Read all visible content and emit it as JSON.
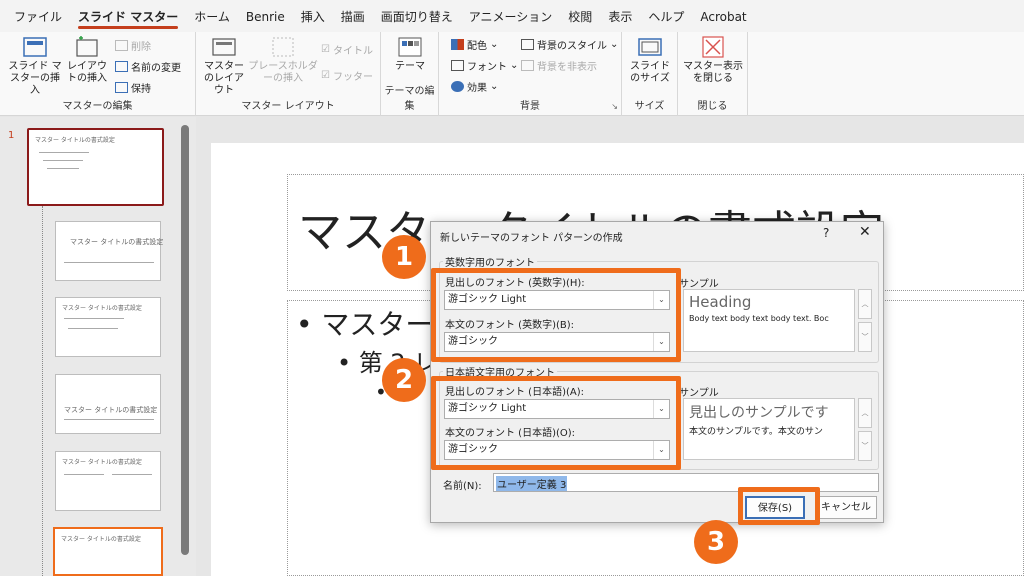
{
  "menubar": {
    "items": [
      "ファイル",
      "スライド マスター",
      "ホーム",
      "Benrie",
      "挿入",
      "描画",
      "画面切り替え",
      "アニメーション",
      "校閲",
      "表示",
      "ヘルプ",
      "Acrobat"
    ]
  },
  "ribbon": {
    "master_edit": {
      "insert_master": "スライド マスターの挿入",
      "insert_layout": "レイアウトの挿入",
      "delete": "削除",
      "rename": "名前の変更",
      "preserve": "保持",
      "label": "マスターの編集"
    },
    "master_layout": {
      "master_layout_btn": "マスターのレイアウト",
      "insert_placeholder": "プレースホルダーの挿入",
      "title_check": "タイトル",
      "footer_check": "フッター",
      "label": "マスター レイアウト"
    },
    "edit_theme": {
      "themes": "テーマ",
      "label": "テーマの編集"
    },
    "background": {
      "colors": "配色",
      "fonts": "フォント",
      "effects": "効果",
      "bg_styles": "背景のスタイル",
      "hide_bg": "背景を非表示",
      "label": "背景"
    },
    "size": {
      "slide_size": "スライドのサイズ",
      "label": "サイズ"
    },
    "close": {
      "close_master": "マスター表示を閉じる",
      "label": "閉じる"
    }
  },
  "thumbs": {
    "number": "1",
    "master_title": "マスター タイトルの書式設定",
    "layout_title": "マスター タイトルの書式設定"
  },
  "slide": {
    "title": "マスター タイトルの書式設定",
    "bullet1": "• マスター",
    "bullet2": "• 第 2 レ",
    "bullet3": "•"
  },
  "dialog": {
    "title": "新しいテーマのフォント パターンの作成",
    "help": "?",
    "close": "✕",
    "latin": {
      "legend": "英数字用のフォント",
      "heading_label": "見出しのフォント (英数字)(H):",
      "heading_value": "游ゴシック Light",
      "body_label": "本文のフォント (英数字)(B):",
      "body_value": "游ゴシック",
      "sample_label": "サンプル",
      "sample_heading": "Heading",
      "sample_body": "Body text body text body text. Boc"
    },
    "asian": {
      "legend": "日本語文字用のフォント",
      "heading_label": "見出しのフォント (日本語)(A):",
      "heading_value": "游ゴシック Light",
      "body_label": "本文のフォント (日本語)(O):",
      "body_value": "游ゴシック",
      "sample_label": "サンプル",
      "sample_heading": "見出しのサンプルです",
      "sample_body": "本文のサンプルです。本文のサン"
    },
    "name_label": "名前(N):",
    "name_value": "ユーザー定義 3",
    "save": "保存(S)",
    "cancel": "キャンセル"
  },
  "annotations": {
    "step1": "1",
    "step2": "2",
    "step3": "3",
    "color": "#ef6c1b"
  },
  "colors": {
    "accent": "#c43e1c",
    "highlight": "#ef6c1b",
    "selected_thumb": "#8b1a1a"
  }
}
